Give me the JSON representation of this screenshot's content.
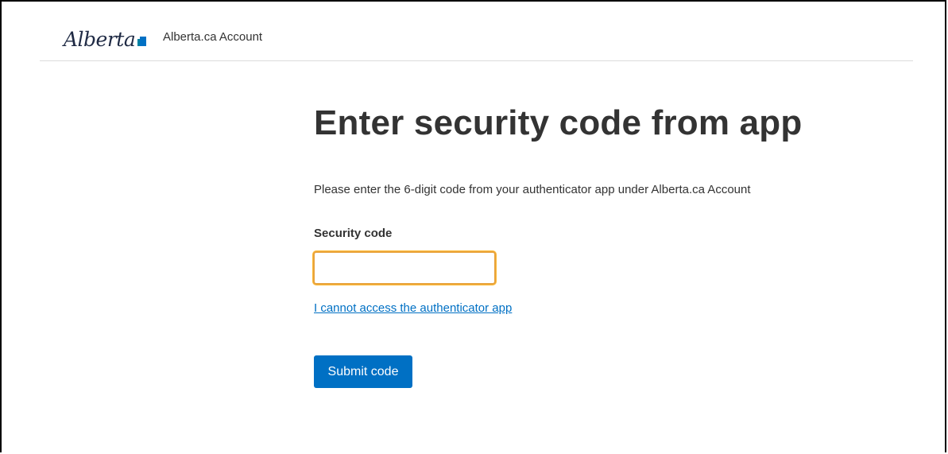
{
  "header": {
    "logo_text": "Alberta",
    "app_name": "Alberta.ca Account"
  },
  "main": {
    "title": "Enter security code from app",
    "description": "Please enter the 6-digit code from your authenticator app under Alberta.ca Account",
    "field_label": "Security code",
    "field_value": "",
    "field_placeholder": "",
    "help_link": "I cannot access the authenticator app",
    "submit_label": "Submit code"
  },
  "colors": {
    "accent": "#0070c4",
    "focus_ring": "#feba35",
    "text": "#333333"
  },
  "icons": {
    "logo": "alberta-logo-icon"
  }
}
